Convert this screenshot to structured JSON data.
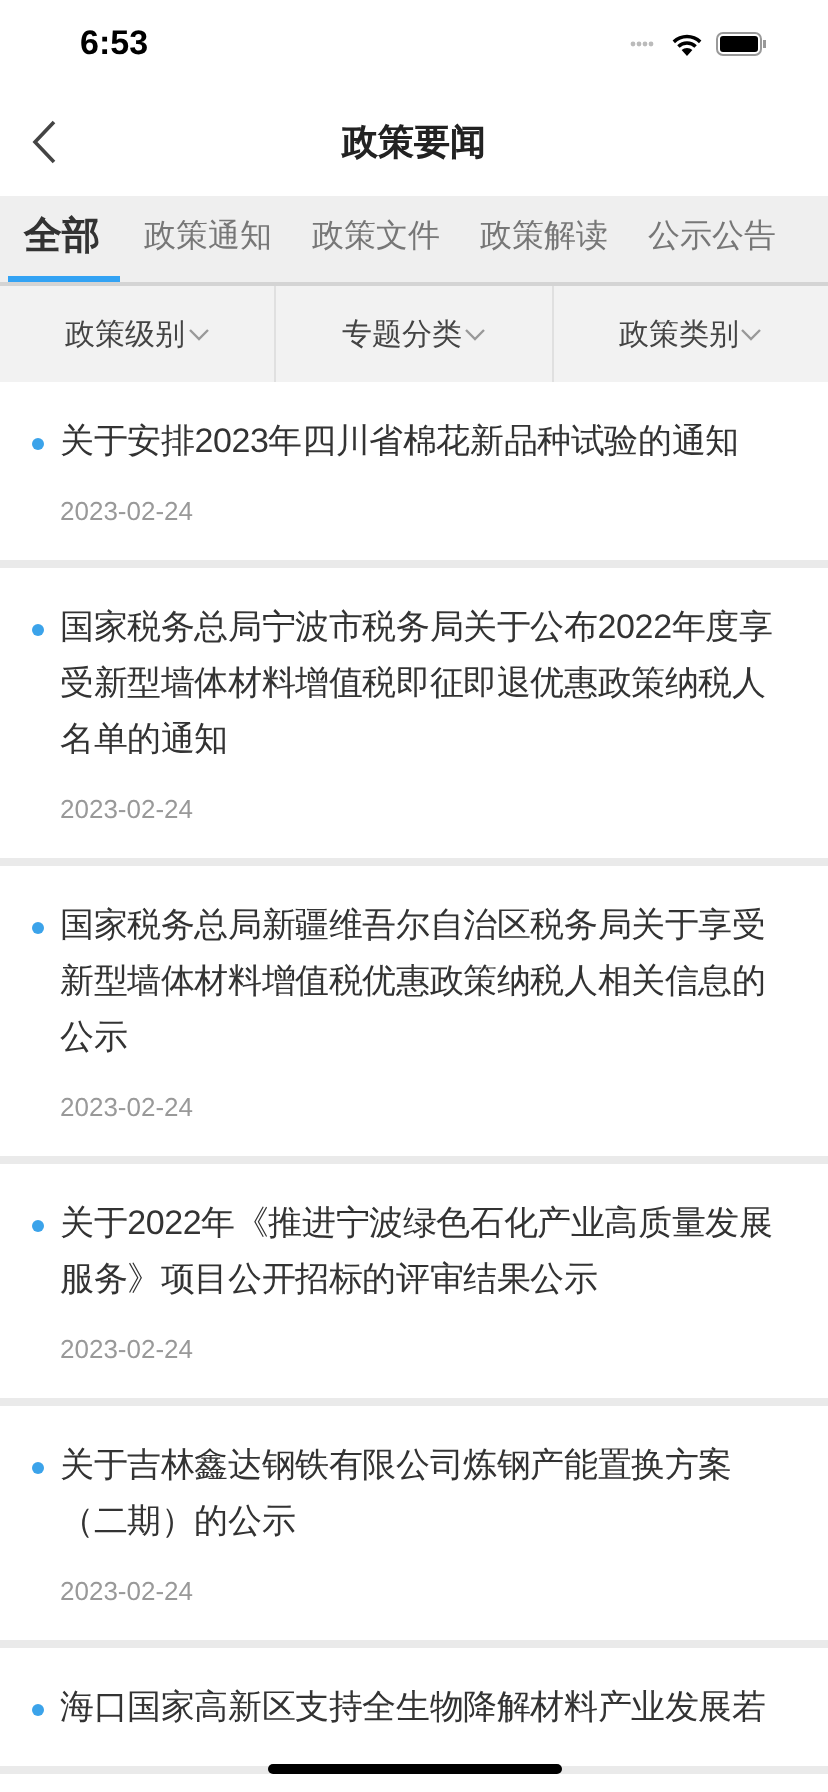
{
  "status_bar": {
    "time": "6:53"
  },
  "nav": {
    "title": "政策要闻"
  },
  "tabs": [
    {
      "label": "全部",
      "selected": true
    },
    {
      "label": "政策通知",
      "selected": false
    },
    {
      "label": "政策文件",
      "selected": false
    },
    {
      "label": "政策解读",
      "selected": false
    },
    {
      "label": "公示公告",
      "selected": false
    }
  ],
  "filters": [
    {
      "label": "政策级别"
    },
    {
      "label": "专题分类"
    },
    {
      "label": "政策类别"
    }
  ],
  "articles": [
    {
      "title": "关于安排2023年四川省棉花新品种试验的通知",
      "date": "2023-02-24"
    },
    {
      "title": "国家税务总局宁波市税务局关于公布2022年度享受新型墙体材料增值税即征即退优惠政策纳税人名单的通知",
      "date": "2023-02-24"
    },
    {
      "title": "国家税务总局新疆维吾尔自治区税务局关于享受新型墙体材料增值税优惠政策纳税人相关信息的公示",
      "date": "2023-02-24"
    },
    {
      "title": "关于2022年《推进宁波绿色石化产业高质量发展服务》项目公开招标的评审结果公示",
      "date": "2023-02-24"
    },
    {
      "title": "关于吉林鑫达钢铁有限公司炼钢产能置换方案（二期）的公示",
      "date": "2023-02-24"
    },
    {
      "title": "海口国家高新区支持全生物降解材料产业发展若"
    }
  ]
}
